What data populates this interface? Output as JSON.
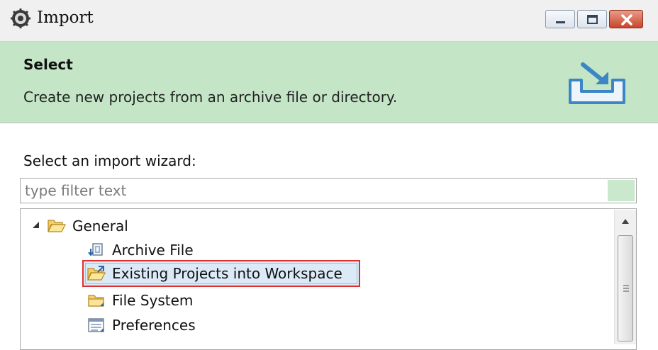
{
  "window": {
    "title": "Import",
    "icon": "eclipse-gear-icon",
    "controls": [
      "minimize",
      "maximize",
      "close"
    ]
  },
  "banner": {
    "title": "Select",
    "description": "Create new projects from an archive file or directory.",
    "icon": "import-wizard-icon",
    "background_color": "#c4e6c7"
  },
  "wizard": {
    "label": "Select an import wizard:",
    "filter_placeholder": "type filter text",
    "filter_value": ""
  },
  "tree": {
    "items": [
      {
        "label": "General",
        "icon": "folder-open-icon",
        "expanded": true
      },
      {
        "label": "Archive File",
        "icon": "archive-file-icon"
      },
      {
        "label": "Existing Projects into Workspace",
        "icon": "existing-project-icon",
        "selected": true
      },
      {
        "label": "File System",
        "icon": "folder-icon"
      },
      {
        "label": "Preferences",
        "icon": "preferences-icon"
      }
    ],
    "highlight_color": "#e03030"
  }
}
